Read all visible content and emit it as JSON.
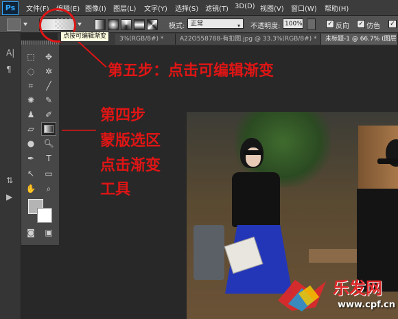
{
  "app": {
    "logo": "Ps"
  },
  "menu": [
    {
      "label": "文件(F)"
    },
    {
      "label": "编辑(E)"
    },
    {
      "label": "图像(I)"
    },
    {
      "label": "图层(L)"
    },
    {
      "label": "文字(Y)"
    },
    {
      "label": "选择(S)"
    },
    {
      "label": "滤镜(T)"
    },
    {
      "label": "3D(D)"
    },
    {
      "label": "视图(V)"
    },
    {
      "label": "窗口(W)"
    },
    {
      "label": "帮助(H)"
    }
  ],
  "options": {
    "mode_label": "模式:",
    "mode_value": "正常",
    "opacity_label": "不透明度:",
    "opacity_value": "100%",
    "reverse_label": "反向",
    "dither_label": "仿色",
    "check_mark": "✓"
  },
  "tooltip": "点按可编辑渐变",
  "tabs": [
    {
      "label": "3%(RGB/8#) *"
    },
    {
      "label": "A22O558788-有扣图.jpg @ 33.3%(RGB/8#) *"
    },
    {
      "label": "未标题-1 @ 66.7% (图层"
    }
  ],
  "annotations": {
    "step5": "第五步：点击可编辑渐变",
    "step4_lines": [
      "第四步",
      "蒙版选区",
      "点击渐变",
      "工具"
    ]
  },
  "watermark": {
    "title": "乐发网",
    "url": "www.cpf.cn"
  },
  "colors": {
    "annotation_red": "#e01515",
    "foreground": "#b4b4b4",
    "background": "#ffffff",
    "ps_blue": "#31a8ff"
  },
  "icons": {
    "tools": [
      "marquee-icon",
      "move-icon",
      "lasso-icon",
      "magic-wand-icon",
      "crop-icon",
      "eyedropper-icon",
      "spot-healing-icon",
      "brush-icon",
      "clone-stamp-icon",
      "history-brush-icon",
      "eraser-icon",
      "gradient-icon",
      "blur-icon",
      "dodge-icon",
      "pen-icon",
      "type-icon",
      "path-select-icon",
      "shape-icon",
      "hand-icon",
      "zoom-icon"
    ]
  }
}
